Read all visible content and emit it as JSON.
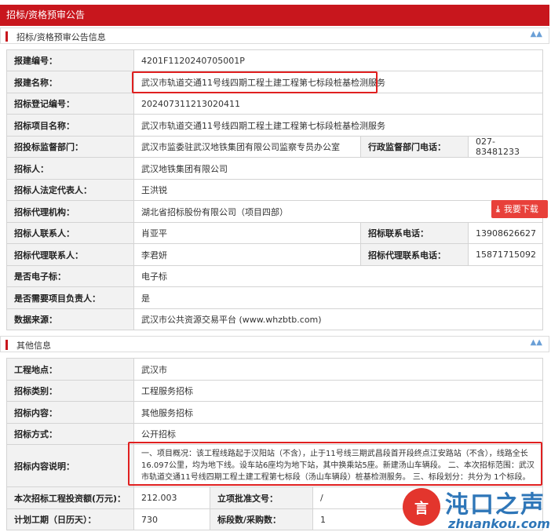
{
  "page_title": "招标/资格预审公告",
  "section1": {
    "title": "招标/资格预审公告信息",
    "rows": [
      {
        "label": "报建编号：",
        "value": "4201F1120240705001P"
      },
      {
        "label": "报建名称：",
        "value": "武汉市轨道交通11号线四期工程土建工程第七标段桩基检测服务"
      },
      {
        "label": "招标登记编号：",
        "value": "202407311213020411"
      },
      {
        "label": "招标项目名称：",
        "value": "武汉市轨道交通11号线四期工程土建工程第七标段桩基检测服务"
      },
      {
        "label": "招投标监督部门：",
        "value": "武汉市监委驻武汉地铁集团有限公司监察专员办公室",
        "label2": "行政监督部门电话：",
        "value2": "027-83481233"
      },
      {
        "label": "招标人：",
        "value": "武汉地铁集团有限公司"
      },
      {
        "label": "招标人法定代表人：",
        "value": "王洪锐"
      },
      {
        "label": "招标代理机构：",
        "value": "湖北省招标股份有限公司（项目四部）"
      },
      {
        "label": "招标人联系人：",
        "value": "肖亚平",
        "label2": "招标联系电话：",
        "value2": "13908626627"
      },
      {
        "label": "招标代理联系人：",
        "value": "李君妍",
        "label2": "招标代理联系电话：",
        "value2": "15871715092"
      },
      {
        "label": "是否电子标：",
        "value": "电子标"
      },
      {
        "label": "是否需要项目负责人：",
        "value": "是"
      },
      {
        "label": "数据来源：",
        "value": "武汉市公共资源交易平台 (www.whzbtb.com)"
      }
    ]
  },
  "download_button": "我要下载",
  "section2": {
    "title": "其他信息",
    "rows": [
      {
        "label": "工程地点：",
        "value": "武汉市"
      },
      {
        "label": "招标类别：",
        "value": "工程服务招标"
      },
      {
        "label": "招标内容：",
        "value": "其他服务招标"
      },
      {
        "label": "招标方式：",
        "value": "公开招标"
      },
      {
        "label": "招标内容说明：",
        "value": "一、项目概况：该工程线路起于汉阳站（不含），止于11号线三期武昌段首开段终点江安路站（不含），线路全长16.097公里，均为地下线。设车站6座均为地下站，其中换乘站5座。新建汤山车辆段。 二、本次招标范围：武汉市轨道交通11号线四期工程土建工程第七标段（汤山车辆段）桩基检测服务。 三、标段划分：共分为 1个标段。"
      },
      {
        "label": "本次招标工程投资额(万元)：",
        "value": "212.003",
        "label2": "立项批准文号：",
        "value2": "/"
      },
      {
        "label": "计划工期（日历天）：",
        "value": "730",
        "label2": "标段数/采购数：",
        "value2": "1"
      }
    ]
  },
  "watermark": {
    "brand": "沌口之声",
    "domain": "zhuankou.com",
    "logo_text": "言"
  },
  "colors": {
    "header_red": "#c8161d",
    "label_bg": "#f2f2f2",
    "highlight_red": "#e02020",
    "brand_blue": "#2e76b8"
  }
}
